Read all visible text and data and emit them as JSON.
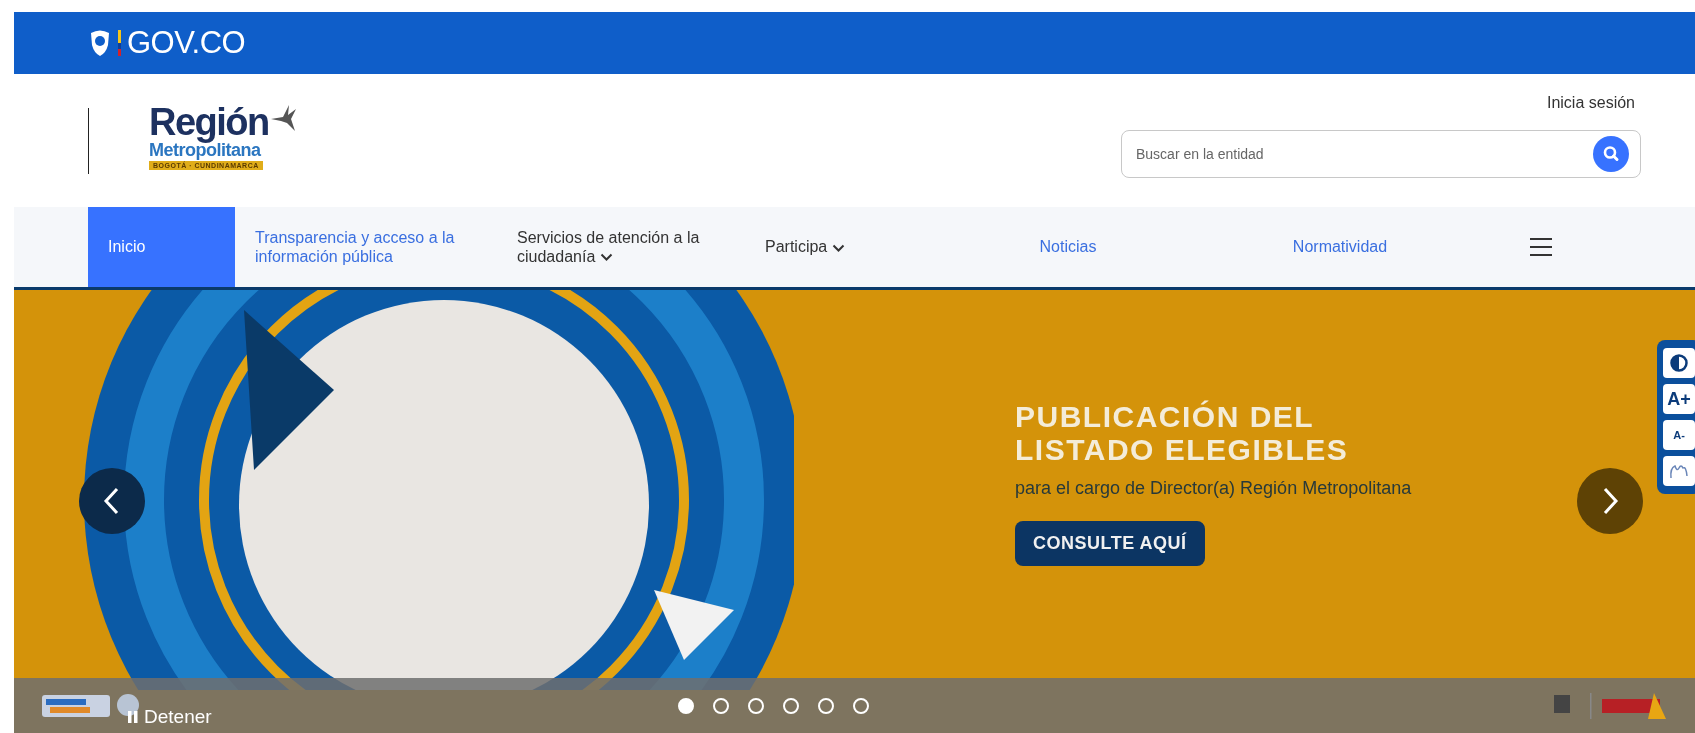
{
  "gov_bar": {
    "brand": "GOV.CO"
  },
  "header": {
    "logo": {
      "title": "Región",
      "subtitle": "Metropolitana",
      "tagline": "BOGOTÁ · CUNDINAMARCA"
    },
    "login": "Inicia sesión",
    "search": {
      "placeholder": "Buscar en la entidad"
    }
  },
  "nav": [
    {
      "label": "Inicio",
      "kind": "link",
      "selected": true
    },
    {
      "label": "Transparencia y acceso a la información pública",
      "kind": "link",
      "selected": false
    },
    {
      "label": "Servicios de atención a la ciudadanía",
      "kind": "dropdown",
      "selected": false
    },
    {
      "label": "Participa",
      "kind": "dropdown",
      "selected": false
    },
    {
      "label": "Noticias",
      "kind": "link",
      "selected": false
    },
    {
      "label": "Normatividad",
      "kind": "link",
      "selected": false
    }
  ],
  "banner": {
    "heading": "PUBLICACIÓN DEL LISTADO ELEGIBLES",
    "subtitle": "para el cargo de Director(a) Región Metropolitana",
    "button": "CONSULTE AQUÍ",
    "pause": "Detener",
    "dots": [
      {
        "selected": true
      },
      {
        "selected": false
      },
      {
        "selected": false
      },
      {
        "selected": false
      },
      {
        "selected": false
      },
      {
        "selected": false
      }
    ]
  },
  "accessibility": [
    {
      "kind": "contrast"
    },
    {
      "kind": "text",
      "label": "A+"
    },
    {
      "kind": "small",
      "label": "A-"
    },
    {
      "kind": "sign"
    }
  ]
}
